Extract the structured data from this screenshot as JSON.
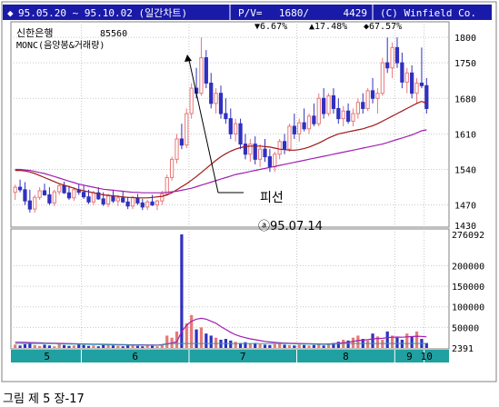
{
  "header": {
    "date_range": "95.05.20 ~ 95.10.02 (일간차트)",
    "pv_label": "P/V=",
    "pv_value": "1680/",
    "pv_value2": "4429",
    "copyright": "(C) Winfield Co."
  },
  "stats": {
    "down_pct": "▼6.67%",
    "up_pct": "▲17.48%",
    "diamond_pct": "◆67.57%"
  },
  "stock": {
    "name": "신한은행",
    "price": "85560",
    "indicator": "MONC(음양봉&거래량)"
  },
  "annotation": {
    "label": "피선",
    "date": "ⓐ95.07.14"
  },
  "caption": "그림 제 5 장-17",
  "colors": {
    "background": "#ffffff",
    "header_bg": "#1a1aa8",
    "header_text": "#ffffff",
    "up_candle": "#e87878",
    "down_candle": "#3030c0",
    "ma_short": "#a01818",
    "ma_long": "#a020b0",
    "volume_line": "#a020b0",
    "volume_line2": "#20a0a0",
    "month_bar": "#20a0a0",
    "grid": "#c8c8c8"
  },
  "chart_data": [
    {
      "type": "candlestick",
      "title": "",
      "y_ticks": [
        1800,
        1750,
        1680,
        1610,
        1540,
        1470,
        1430
      ],
      "ylim": [
        1430,
        1820
      ],
      "x_ticks": [
        "5",
        "6",
        "7",
        "8",
        "9",
        "10"
      ],
      "candles": [
        [
          1495,
          1510,
          1480,
          1505
        ],
        [
          1505,
          1520,
          1495,
          1500
        ],
        [
          1500,
          1515,
          1470,
          1478
        ],
        [
          1478,
          1500,
          1455,
          1462
        ],
        [
          1462,
          1490,
          1455,
          1485
        ],
        [
          1485,
          1505,
          1480,
          1498
        ],
        [
          1498,
          1512,
          1488,
          1490
        ],
        [
          1490,
          1505,
          1470,
          1474
        ],
        [
          1474,
          1500,
          1468,
          1496
        ],
        [
          1496,
          1512,
          1490,
          1508
        ],
        [
          1508,
          1516,
          1492,
          1494
        ],
        [
          1494,
          1508,
          1480,
          1484
        ],
        [
          1484,
          1505,
          1478,
          1500
        ],
        [
          1500,
          1512,
          1490,
          1495
        ],
        [
          1495,
          1510,
          1482,
          1486
        ],
        [
          1486,
          1500,
          1472,
          1476
        ],
        [
          1476,
          1498,
          1470,
          1494
        ],
        [
          1494,
          1505,
          1480,
          1482
        ],
        [
          1482,
          1495,
          1468,
          1472
        ],
        [
          1472,
          1492,
          1466,
          1488
        ],
        [
          1488,
          1500,
          1474,
          1478
        ],
        [
          1478,
          1490,
          1468,
          1484
        ],
        [
          1484,
          1498,
          1474,
          1476
        ],
        [
          1476,
          1486,
          1462,
          1468
        ],
        [
          1468,
          1488,
          1462,
          1484
        ],
        [
          1484,
          1492,
          1470,
          1474
        ],
        [
          1474,
          1482,
          1460,
          1466
        ],
        [
          1466,
          1480,
          1460,
          1476
        ],
        [
          1476,
          1490,
          1468,
          1470
        ],
        [
          1470,
          1480,
          1460,
          1478
        ],
        [
          1478,
          1498,
          1470,
          1492
        ],
        [
          1492,
          1530,
          1488,
          1524
        ],
        [
          1524,
          1565,
          1518,
          1560
        ],
        [
          1560,
          1610,
          1552,
          1600
        ],
        [
          1600,
          1630,
          1580,
          1588
        ],
        [
          1588,
          1660,
          1582,
          1650
        ],
        [
          1650,
          1710,
          1640,
          1700
        ],
        [
          1700,
          1740,
          1680,
          1690
        ],
        [
          1690,
          1800,
          1685,
          1760
        ],
        [
          1760,
          1775,
          1700,
          1710
        ],
        [
          1710,
          1730,
          1660,
          1670
        ],
        [
          1670,
          1700,
          1650,
          1690
        ],
        [
          1690,
          1705,
          1640,
          1650
        ],
        [
          1650,
          1680,
          1630,
          1640
        ],
        [
          1640,
          1660,
          1600,
          1610
        ],
        [
          1610,
          1640,
          1595,
          1630
        ],
        [
          1630,
          1640,
          1580,
          1590
        ],
        [
          1590,
          1610,
          1560,
          1570
        ],
        [
          1570,
          1600,
          1555,
          1590
        ],
        [
          1590,
          1605,
          1550,
          1560
        ],
        [
          1560,
          1590,
          1545,
          1580
        ],
        [
          1580,
          1600,
          1555,
          1565
        ],
        [
          1565,
          1580,
          1535,
          1545
        ],
        [
          1545,
          1575,
          1535,
          1570
        ],
        [
          1570,
          1600,
          1560,
          1595
        ],
        [
          1595,
          1610,
          1570,
          1580
        ],
        [
          1580,
          1630,
          1575,
          1625
        ],
        [
          1625,
          1650,
          1600,
          1610
        ],
        [
          1610,
          1640,
          1595,
          1632
        ],
        [
          1632,
          1660,
          1615,
          1620
        ],
        [
          1620,
          1650,
          1610,
          1645
        ],
        [
          1645,
          1670,
          1625,
          1630
        ],
        [
          1630,
          1690,
          1625,
          1680
        ],
        [
          1680,
          1700,
          1640,
          1650
        ],
        [
          1650,
          1690,
          1645,
          1685
        ],
        [
          1685,
          1700,
          1650,
          1660
        ],
        [
          1660,
          1680,
          1630,
          1640
        ],
        [
          1640,
          1665,
          1625,
          1655
        ],
        [
          1655,
          1670,
          1630,
          1635
        ],
        [
          1635,
          1660,
          1625,
          1650
        ],
        [
          1650,
          1680,
          1640,
          1672
        ],
        [
          1672,
          1690,
          1650,
          1660
        ],
        [
          1660,
          1700,
          1655,
          1695
        ],
        [
          1695,
          1720,
          1670,
          1680
        ],
        [
          1680,
          1700,
          1650,
          1690
        ],
        [
          1690,
          1760,
          1685,
          1750
        ],
        [
          1750,
          1800,
          1730,
          1740
        ],
        [
          1740,
          1790,
          1720,
          1780
        ],
        [
          1780,
          1800,
          1740,
          1750
        ],
        [
          1750,
          1770,
          1700,
          1712
        ],
        [
          1712,
          1740,
          1690,
          1730
        ],
        [
          1730,
          1745,
          1680,
          1690
        ],
        [
          1690,
          1720,
          1670,
          1710
        ],
        [
          1710,
          1780,
          1700,
          1705
        ],
        [
          1705,
          1720,
          1650,
          1660
        ]
      ],
      "ma_short": [
        1538,
        1538,
        1537,
        1535,
        1532,
        1528,
        1524,
        1520,
        1516,
        1512,
        1509,
        1506,
        1503,
        1500,
        1498,
        1496,
        1494,
        1492,
        1490,
        1489,
        1488,
        1487,
        1486,
        1485,
        1485,
        1484,
        1484,
        1484,
        1485,
        1486,
        1487,
        1490,
        1494,
        1500,
        1506,
        1512,
        1519,
        1526,
        1534,
        1542,
        1550,
        1558,
        1565,
        1571,
        1576,
        1580,
        1583,
        1585,
        1586,
        1586,
        1586,
        1585,
        1584,
        1582,
        1580,
        1579,
        1578,
        1578,
        1579,
        1581,
        1584,
        1588,
        1592,
        1597,
        1602,
        1606,
        1610,
        1612,
        1614,
        1616,
        1618,
        1620,
        1623,
        1626,
        1630,
        1635,
        1640,
        1645,
        1650,
        1655,
        1660,
        1665,
        1670,
        1674,
        1670
      ],
      "ma_long": [
        1540,
        1540,
        1539,
        1538,
        1536,
        1534,
        1532,
        1529,
        1526,
        1523,
        1520,
        1517,
        1514,
        1511,
        1509,
        1507,
        1505,
        1503,
        1501,
        1500,
        1499,
        1498,
        1497,
        1496,
        1495,
        1495,
        1494,
        1494,
        1494,
        1494,
        1494,
        1495,
        1496,
        1497,
        1499,
        1501,
        1503,
        1506,
        1509,
        1512,
        1515,
        1518,
        1521,
        1524,
        1527,
        1530,
        1532,
        1534,
        1536,
        1538,
        1540,
        1542,
        1544,
        1546,
        1548,
        1550,
        1552,
        1554,
        1556,
        1558,
        1560,
        1562,
        1564,
        1566,
        1568,
        1570,
        1572,
        1574,
        1576,
        1578,
        1580,
        1582,
        1584,
        1586,
        1588,
        1590,
        1593,
        1596,
        1599,
        1602,
        1605,
        1608,
        1612,
        1616,
        1618
      ]
    },
    {
      "type": "bar",
      "title": "",
      "y_ticks": [
        276092,
        200000,
        150000,
        100000,
        50000,
        2391
      ],
      "ylim": [
        0,
        276092
      ],
      "volume": [
        8000,
        6000,
        9000,
        12000,
        7000,
        5000,
        8000,
        6000,
        4000,
        9000,
        7000,
        5000,
        6000,
        8000,
        7000,
        5000,
        6000,
        4000,
        7000,
        9000,
        6000,
        5000,
        4000,
        6000,
        7000,
        5000,
        4000,
        6000,
        5000,
        4000,
        9000,
        30000,
        25000,
        40000,
        276092,
        60000,
        80000,
        45000,
        50000,
        35000,
        30000,
        25000,
        20000,
        22000,
        18000,
        15000,
        12000,
        14000,
        10000,
        12000,
        9000,
        8000,
        7000,
        9000,
        10000,
        8000,
        7000,
        6000,
        8000,
        7000,
        6000,
        7000,
        8000,
        6000,
        9000,
        12000,
        15000,
        20000,
        18000,
        25000,
        30000,
        22000,
        18000,
        35000,
        28000,
        20000,
        40000,
        30000,
        25000,
        20000,
        35000,
        28000,
        40000,
        22000,
        12000
      ],
      "vol_ma": [
        14000,
        14000,
        13500,
        13000,
        12800,
        12500,
        12000,
        11800,
        11500,
        11000,
        10800,
        10500,
        10200,
        10000,
        9800,
        9500,
        9200,
        9000,
        8800,
        8600,
        8400,
        8200,
        8000,
        7800,
        7600,
        7500,
        7400,
        7300,
        7200,
        7100,
        8000,
        10000,
        12000,
        15000,
        40000,
        55000,
        65000,
        70000,
        72000,
        70000,
        65000,
        60000,
        52000,
        45000,
        38000,
        32000,
        28000,
        25000,
        22000,
        20000,
        18000,
        16000,
        14500,
        13500,
        12500,
        12000,
        11500,
        11000,
        10800,
        10500,
        10200,
        10000,
        9800,
        9600,
        9800,
        10200,
        11000,
        12500,
        14000,
        16000,
        18000,
        19000,
        20000,
        22000,
        23000,
        23500,
        25000,
        26000,
        26500,
        26000,
        27000,
        27500,
        28500,
        28000,
        27000
      ]
    }
  ]
}
